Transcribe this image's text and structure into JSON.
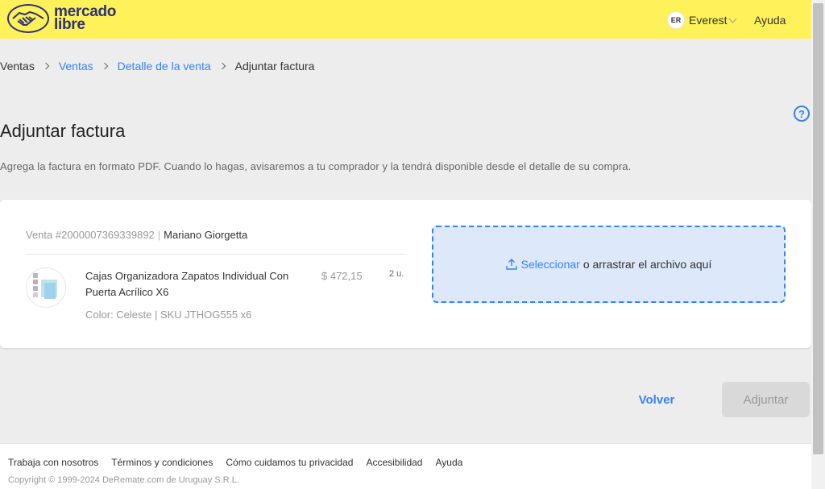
{
  "header": {
    "logo_line1": "mercado",
    "logo_line2": "libre",
    "user_initials": "ER",
    "user_name": "Everest",
    "help": "Ayuda"
  },
  "breadcrumb": {
    "items": [
      "Ventas",
      "Ventas",
      "Detalle de la venta",
      "Adjuntar factura"
    ]
  },
  "page": {
    "title": "Adjuntar factura",
    "description": "Agrega la factura en formato PDF. Cuando lo hagas, avisaremos a tu comprador y la tendrá disponible desde el detalle de su compra."
  },
  "sale": {
    "id": "Venta #2000007369339892",
    "buyer": "Mariano Giorgetta",
    "product_title": "Cajas Organizadora Zapatos Individual Con Puerta Acrílico X6",
    "price": "$ 472,15",
    "quantity": "2 u.",
    "variant": "Color: Celeste | SKU JTHOG555 x6"
  },
  "dropzone": {
    "link": "Seleccionar",
    "text": "o arrastrar el archivo aquí"
  },
  "actions": {
    "back": "Volver",
    "submit": "Adjuntar"
  },
  "footer": {
    "links": [
      "Trabaja con nosotros",
      "Términos y condiciones",
      "Cómo cuidamos tu privacidad",
      "Accesibilidad",
      "Ayuda"
    ],
    "copyright": "Copyright © 1999-2024 DeRemate.com de Uruguay S.R.L."
  },
  "colors": {
    "brand_yellow": "#fff159",
    "accent_blue": "#3483fa"
  }
}
